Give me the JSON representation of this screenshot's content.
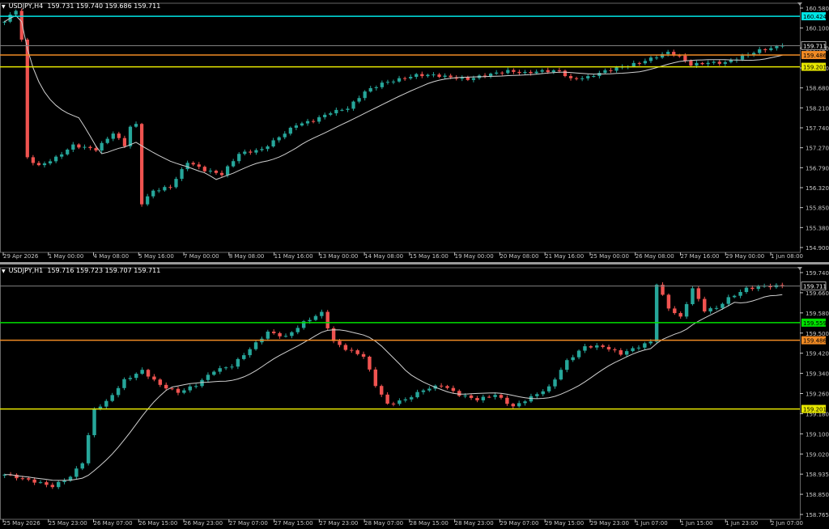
{
  "colors": {
    "bull": "#26a69a",
    "bear": "#ef5350",
    "grid": "#666666",
    "axis": "#c8c8c8",
    "ma": "#d0d0d0",
    "line_cyan": "#00e5e5",
    "line_orange": "#f08a24",
    "line_yellow": "#e6e600",
    "line_green": "#00e000",
    "price_line": "#808080"
  },
  "h4": {
    "title": "USDJPY,H4",
    "ohlc": "159.731 159.740 159.686 159.711",
    "y_ticks": [
      "160.580",
      "160.100",
      "159.620",
      "159.150",
      "158.680",
      "158.210",
      "157.740",
      "157.270",
      "156.790",
      "156.320",
      "155.850",
      "155.380",
      "154.900"
    ],
    "x_ticks": [
      "29 Apr 2026",
      "1 May 00:00",
      "4 May 08:00",
      "5 May 16:00",
      "7 May 00:00",
      "8 May 08:00",
      "11 May 16:00",
      "13 May 00:00",
      "14 May 08:00",
      "15 May 16:00",
      "19 May 00:00",
      "20 May 08:00",
      "21 May 16:00",
      "25 May 00:00",
      "26 May 08:00",
      "27 May 16:00",
      "29 May 00:00",
      "1 Jun 08:00"
    ],
    "levels": [
      {
        "price": 160.424,
        "label": "160.424",
        "color": "cyan"
      },
      {
        "price": 159.486,
        "label": "159.486",
        "color": "orange"
      },
      {
        "price": 159.201,
        "label": "159.201",
        "color": "yellow"
      }
    ],
    "current_price": {
      "price": 159.711,
      "label": "159.711"
    },
    "chart_data": {
      "type": "candlestick",
      "symbol": "USDJPY",
      "timeframe": "H4",
      "ylim": [
        154.75,
        160.7
      ],
      "anchors": [
        [
          0,
          160.3
        ],
        [
          2,
          160.58
        ],
        [
          3,
          159.85
        ],
        [
          4,
          157.0
        ],
        [
          6,
          156.8
        ],
        [
          9,
          157.0
        ],
        [
          12,
          157.3
        ],
        [
          16,
          157.2
        ],
        [
          19,
          157.6
        ],
        [
          21,
          157.3
        ],
        [
          22,
          157.75
        ],
        [
          23,
          157.8
        ],
        [
          24,
          155.9
        ],
        [
          26,
          156.2
        ],
        [
          29,
          156.3
        ],
        [
          32,
          156.9
        ],
        [
          35,
          156.7
        ],
        [
          38,
          156.6
        ],
        [
          41,
          157.1
        ],
        [
          45,
          157.2
        ],
        [
          48,
          157.5
        ],
        [
          51,
          157.8
        ],
        [
          54,
          157.9
        ],
        [
          57,
          158.1
        ],
        [
          60,
          158.2
        ],
        [
          63,
          158.6
        ],
        [
          66,
          158.8
        ],
        [
          69,
          158.9
        ],
        [
          72,
          159.0
        ],
        [
          75,
          159.0
        ],
        [
          78,
          158.95
        ],
        [
          81,
          158.9
        ],
        [
          84,
          159.0
        ],
        [
          88,
          159.1
        ],
        [
          91,
          159.05
        ],
        [
          94,
          159.1
        ],
        [
          97,
          159.1
        ],
        [
          99,
          158.9
        ],
        [
          102,
          158.95
        ],
        [
          105,
          159.1
        ],
        [
          108,
          159.2
        ],
        [
          111,
          159.3
        ],
        [
          114,
          159.45
        ],
        [
          116,
          159.55
        ],
        [
          118,
          159.45
        ],
        [
          120,
          159.25
        ],
        [
          123,
          159.3
        ],
        [
          126,
          159.3
        ],
        [
          129,
          159.45
        ],
        [
          132,
          159.6
        ],
        [
          134,
          159.65
        ],
        [
          136,
          159.711
        ]
      ]
    }
  },
  "h1": {
    "title": "USDJPY,H1",
    "ohlc": "159.716 159.723 159.707 159.711",
    "y_ticks": [
      "159.740",
      "159.660",
      "159.580",
      "159.500",
      "159.420",
      "159.340",
      "159.260",
      "159.180",
      "159.100",
      "159.020",
      "158.935",
      "158.850",
      "158.765"
    ],
    "x_ticks": [
      "25 May 2026",
      "25 May 23:00",
      "26 May 07:00",
      "26 May 15:00",
      "26 May 23:00",
      "27 May 07:00",
      "27 May 15:00",
      "27 May 23:00",
      "28 May 07:00",
      "28 May 15:00",
      "28 May 23:00",
      "29 May 07:00",
      "29 May 15:00",
      "29 May 23:00",
      "1 Jun 07:00",
      "1 Jun 15:00",
      "1 Jun 23:00",
      "2 Jun 07:00"
    ],
    "levels": [
      {
        "price": 159.559,
        "label": "159.559",
        "color": "green"
      },
      {
        "price": 159.486,
        "label": "159.486",
        "color": "orange"
      },
      {
        "price": 159.201,
        "label": "159.201",
        "color": "yellow"
      }
    ],
    "current_price": {
      "price": 159.711,
      "label": "159.711"
    },
    "chart_data": {
      "type": "candlestick",
      "symbol": "USDJPY",
      "timeframe": "H1",
      "ylim": [
        158.75,
        159.78
      ],
      "anchors": [
        [
          0,
          158.93
        ],
        [
          5,
          158.9
        ],
        [
          8,
          158.88
        ],
        [
          11,
          158.92
        ],
        [
          13,
          158.98
        ],
        [
          15,
          159.2
        ],
        [
          17,
          159.23
        ],
        [
          20,
          159.32
        ],
        [
          23,
          159.36
        ],
        [
          26,
          159.3
        ],
        [
          29,
          159.27
        ],
        [
          32,
          159.3
        ],
        [
          35,
          159.36
        ],
        [
          38,
          159.38
        ],
        [
          41,
          159.45
        ],
        [
          44,
          159.52
        ],
        [
          47,
          159.5
        ],
        [
          50,
          159.56
        ],
        [
          53,
          159.6
        ],
        [
          55,
          159.48
        ],
        [
          57,
          159.45
        ],
        [
          60,
          159.42
        ],
        [
          62,
          159.3
        ],
        [
          64,
          159.22
        ],
        [
          67,
          159.24
        ],
        [
          70,
          159.28
        ],
        [
          73,
          159.3
        ],
        [
          76,
          159.26
        ],
        [
          79,
          159.24
        ],
        [
          82,
          159.26
        ],
        [
          85,
          159.21
        ],
        [
          88,
          159.25
        ],
        [
          91,
          159.29
        ],
        [
          94,
          159.4
        ],
        [
          97,
          159.46
        ],
        [
          100,
          159.46
        ],
        [
          103,
          159.43
        ],
        [
          106,
          159.46
        ],
        [
          108,
          159.48
        ],
        [
          109,
          159.72
        ],
        [
          111,
          159.62
        ],
        [
          113,
          159.58
        ],
        [
          115,
          159.7
        ],
        [
          117,
          159.61
        ],
        [
          119,
          159.62
        ],
        [
          121,
          159.66
        ],
        [
          124,
          159.7
        ],
        [
          127,
          159.71
        ],
        [
          130,
          159.711
        ]
      ]
    }
  }
}
